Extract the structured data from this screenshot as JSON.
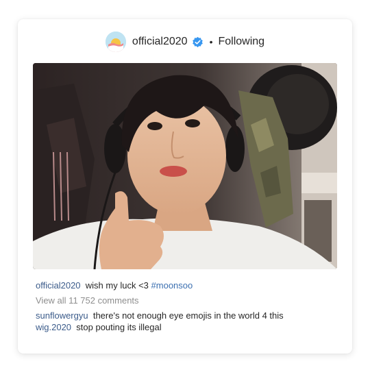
{
  "post": {
    "username": "official2020",
    "separator": "•",
    "follow_label": "Following",
    "caption_user": "official2020",
    "caption_text": "wish my luck <3",
    "caption_tag": "#moonsoo",
    "view_comments": "View all 11 752 comments",
    "comments": [
      {
        "user": "sunflowergyu",
        "text": "there's not enough eye emojis in the world 4 this"
      },
      {
        "user": "wig.2020",
        "text": "stop pouting its illegal"
      }
    ]
  },
  "icons": {
    "avatar": "sunrise-avatar-icon",
    "verified": "verified-badge-icon"
  },
  "colors": {
    "username_link": "#3b5b8a",
    "hashtag": "#3b6fb0",
    "verified_blue": "#3897f0",
    "muted_text": "#8e8e8e"
  }
}
